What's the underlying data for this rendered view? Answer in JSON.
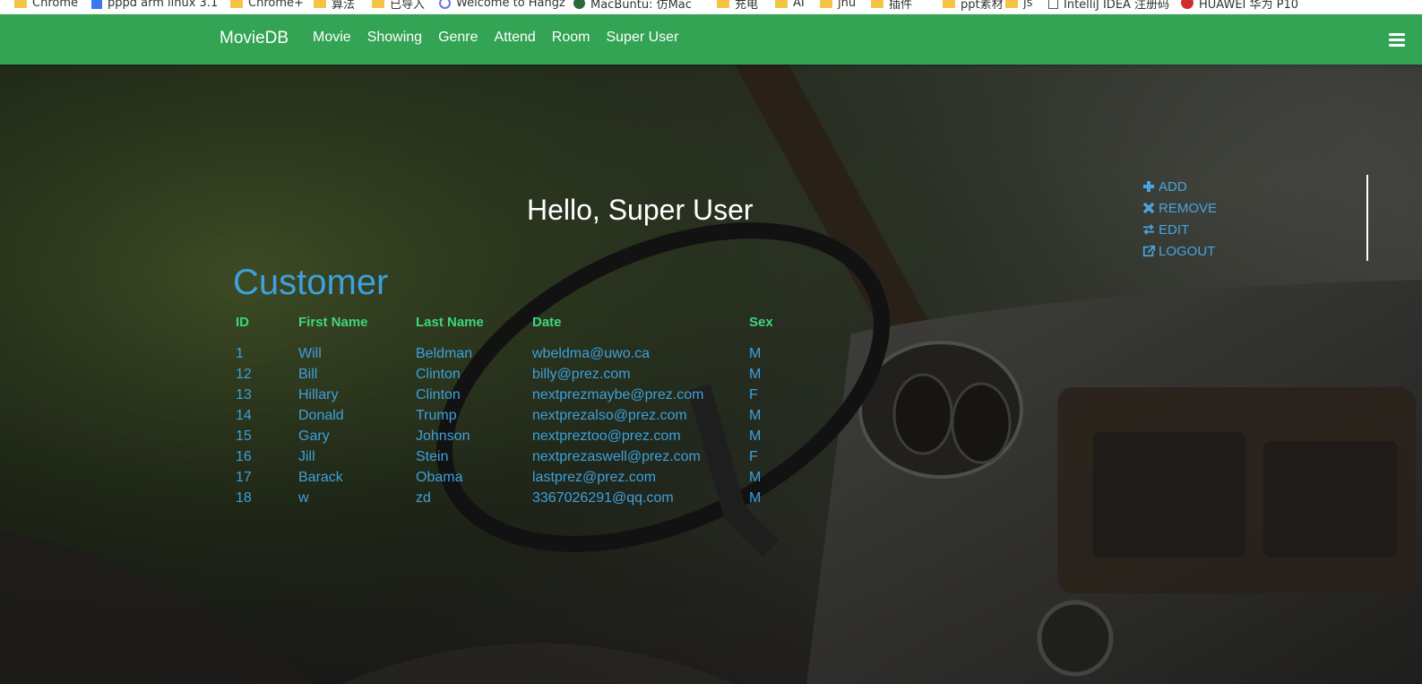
{
  "bookmarks": [
    {
      "label": "Chrome",
      "icon": "folder-icon"
    },
    {
      "label": "pppd arm linux 3.1",
      "icon": "doc-icon"
    },
    {
      "label": "Chrome+",
      "icon": "folder-icon"
    },
    {
      "label": "算法",
      "icon": "folder-icon"
    },
    {
      "label": "已导入",
      "icon": "folder-icon"
    },
    {
      "label": "Welcome to Hangz",
      "icon": "globe-icon"
    },
    {
      "label": "MacBuntu: 仿Mac",
      "icon": "mac-icon"
    },
    {
      "label": "充电",
      "icon": "folder-icon"
    },
    {
      "label": "AI",
      "icon": "folder-icon"
    },
    {
      "label": "jnu",
      "icon": "folder-icon"
    },
    {
      "label": "插件",
      "icon": "folder-icon"
    },
    {
      "label": "ppt素材",
      "icon": "folder-icon"
    },
    {
      "label": "js",
      "icon": "folder-icon"
    },
    {
      "label": "IntelliJ IDEA 注册码",
      "icon": "page-icon"
    },
    {
      "label": "HUAWEI 华为 P10",
      "icon": "huawei-icon"
    }
  ],
  "navbar": {
    "brand": "MovieDB",
    "links": [
      "Movie",
      "Showing",
      "Genre",
      "Attend",
      "Room",
      "Super User"
    ],
    "color": "#33a454"
  },
  "greeting": "Hello, Super User",
  "side_menu": [
    {
      "label": "ADD",
      "icon": "plus-icon"
    },
    {
      "label": "REMOVE",
      "icon": "times-icon"
    },
    {
      "label": "EDIT",
      "icon": "exchange-icon"
    },
    {
      "label": "LOGOUT",
      "icon": "external-link-icon"
    }
  ],
  "section": {
    "title": "Customer",
    "columns": [
      "ID",
      "First Name",
      "Last Name",
      "Date",
      "Sex"
    ],
    "rows": [
      [
        "1",
        "Will",
        "Beldman",
        "wbeldma@uwo.ca",
        "M"
      ],
      [
        "12",
        "Bill",
        "Clinton",
        "billy@prez.com",
        "M"
      ],
      [
        "13",
        "Hillary",
        "Clinton",
        "nextprezmaybe@prez.com",
        "F"
      ],
      [
        "14",
        "Donald",
        "Trump",
        "nextprezalso@prez.com",
        "M"
      ],
      [
        "15",
        "Gary",
        "Johnson",
        "nextpreztoo@prez.com",
        "M"
      ],
      [
        "16",
        "Jill",
        "Stein",
        "nextprezaswell@prez.com",
        "F"
      ],
      [
        "17",
        "Barack",
        "Obama",
        "lastprez@prez.com",
        "M"
      ],
      [
        "18",
        "w",
        "zd",
        "3367026291@qq.com",
        "M"
      ]
    ]
  },
  "colors": {
    "accent_blue": "#3ea0dc",
    "header_green": "#3ed67a"
  }
}
